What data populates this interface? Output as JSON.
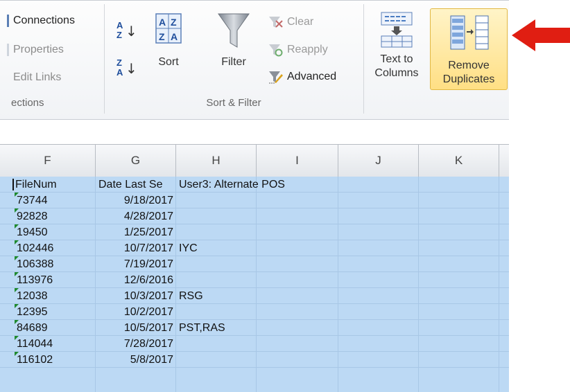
{
  "connections": {
    "items": [
      {
        "label": "Connections",
        "enabled": true
      },
      {
        "label": "Properties",
        "enabled": false
      },
      {
        "label": "Edit Links",
        "enabled": false
      }
    ],
    "group_label": "ections"
  },
  "sort_filter": {
    "sort_label": "Sort",
    "filter_label": "Filter",
    "clear_label": "Clear",
    "reapply_label": "Reapply",
    "advanced_label": "Advanced",
    "group_label": "Sort & Filter",
    "az_glyph_top": "A",
    "az_glyph_bottom": "Z",
    "za_glyph_top": "Z",
    "za_glyph_bottom": "A",
    "arrow_glyph": "↓"
  },
  "data_tools": {
    "text_to_columns": [
      "Text to",
      "Columns"
    ],
    "remove_duplicates": [
      "Remove",
      "Duplicates"
    ]
  },
  "accent": {
    "arrow_color": "#e01e12",
    "selection_color": "#bcd9f4",
    "highlight_color": "#ffdf84"
  },
  "sheet": {
    "columns": [
      "F",
      "G",
      "H",
      "I",
      "J",
      "K"
    ],
    "rows": [
      [
        "FileNum",
        "Date Last Se",
        "User3: Alternate POS"
      ],
      [
        "73744",
        "9/18/2017",
        ""
      ],
      [
        "92828",
        "4/28/2017",
        ""
      ],
      [
        "19450",
        "1/25/2017",
        ""
      ],
      [
        "102446",
        "10/7/2017",
        "IYC"
      ],
      [
        "106388",
        "7/19/2017",
        ""
      ],
      [
        "113976",
        "12/6/2016",
        ""
      ],
      [
        "12038",
        "10/3/2017",
        "RSG"
      ],
      [
        "12395",
        "10/2/2017",
        ""
      ],
      [
        "84689",
        "10/5/2017",
        "PST,RAS"
      ],
      [
        "114044",
        "7/28/2017",
        ""
      ],
      [
        "116102",
        "5/8/2017",
        ""
      ]
    ]
  }
}
